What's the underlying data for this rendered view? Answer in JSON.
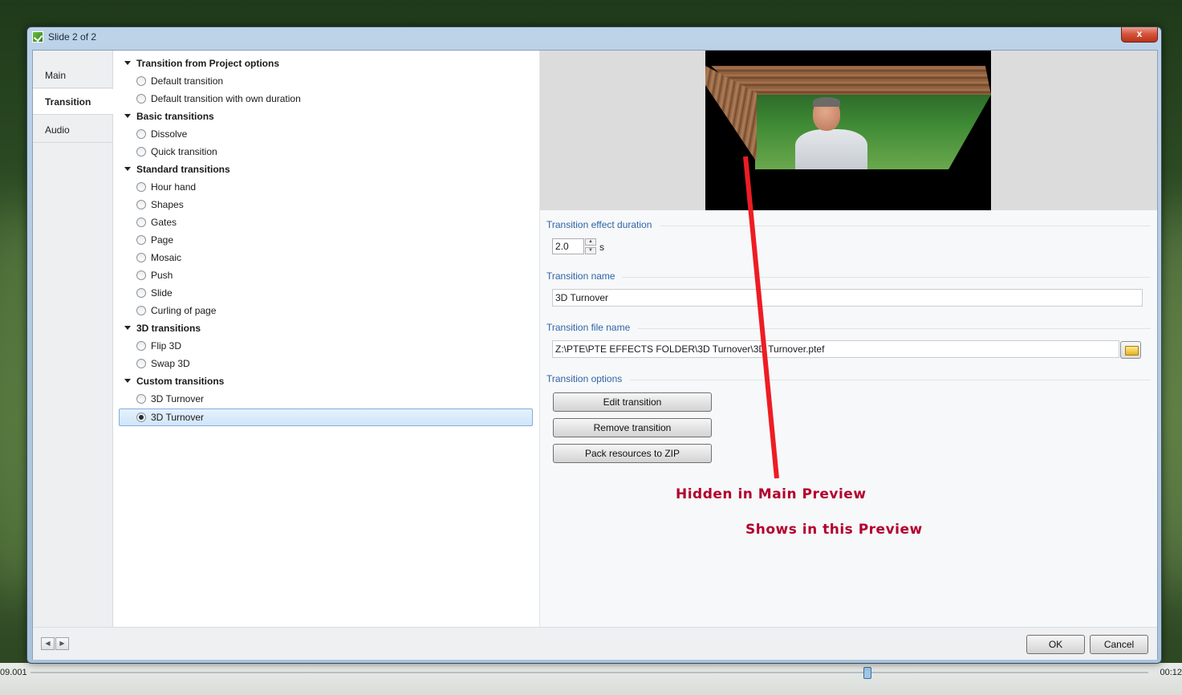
{
  "window": {
    "title": "Slide 2 of 2",
    "close_label": "x"
  },
  "tabs": [
    {
      "label": "Main"
    },
    {
      "label": "Transition"
    },
    {
      "label": "Audio"
    }
  ],
  "tree": {
    "groups": [
      {
        "label": "Transition from Project options",
        "items": [
          "Default transition",
          "Default transition with own duration"
        ]
      },
      {
        "label": "Basic transitions",
        "items": [
          "Dissolve",
          "Quick transition"
        ]
      },
      {
        "label": "Standard transitions",
        "items": [
          "Hour hand",
          "Shapes",
          "Gates",
          "Page",
          "Mosaic",
          "Push",
          "Slide",
          "Curling of page"
        ]
      },
      {
        "label": "3D transitions",
        "items": [
          "Flip 3D",
          "Swap 3D"
        ]
      },
      {
        "label": "Custom transitions",
        "items": [
          "3D Turnover",
          "3D Turnover"
        ]
      }
    ],
    "selected_item": "3D Turnover"
  },
  "right": {
    "duration_label": "Transition effect duration",
    "duration_value": "2.0",
    "duration_unit": "s",
    "name_label": "Transition name",
    "name_value": "3D Turnover",
    "file_label": "Transition file name",
    "file_value": "Z:\\PTE\\PTE EFFECTS FOLDER\\3D Turnover\\3D Turnover.ptef",
    "options_label": "Transition options",
    "buttons": {
      "edit": "Edit transition",
      "remove": "Remove transition",
      "pack": "Pack resources to ZIP"
    }
  },
  "annotations": {
    "line1": "Hidden in Main Preview",
    "line2": "Shows in this Preview",
    "color": "#b2002d"
  },
  "footer": {
    "ok": "OK",
    "cancel": "Cancel"
  },
  "timeline": {
    "left_time": "09.001",
    "right_time": "00:12"
  }
}
